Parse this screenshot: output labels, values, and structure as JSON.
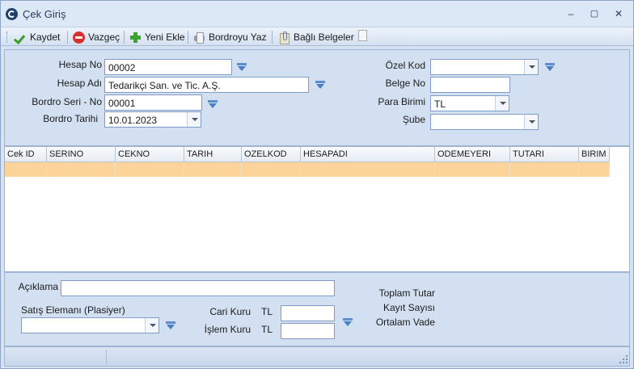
{
  "window": {
    "title": "Çek Giriş",
    "controls": [
      "–",
      "▢",
      "✕"
    ]
  },
  "toolbar": {
    "save_label": "Kaydet",
    "cancel_label": "Vazgeç",
    "new_label": "Yeni Ekle",
    "print_label": "Bordroyu Yaz",
    "attachments_label": "Bağlı Belgeler"
  },
  "header_form": {
    "account_no": {
      "label": "Hesap No",
      "value": "00002"
    },
    "account_name": {
      "label": "Hesap Adı",
      "value": "Tedarikçi San. ve Tic. A.Ş."
    },
    "bordro_serial": {
      "label": "Bordro Seri - No",
      "value": "00001"
    },
    "bordro_date": {
      "label": "Bordro Tarihi",
      "value": "10.01.2023"
    },
    "special_code": {
      "label": "Özel Kod",
      "value": ""
    },
    "document_no": {
      "label": "Belge No",
      "value": ""
    },
    "currency": {
      "label": "Para Birimi",
      "value": "TL"
    },
    "branch": {
      "label": "Şube",
      "value": ""
    }
  },
  "grid": {
    "columns": [
      "Cek ID",
      "SERINO",
      "CEKNO",
      "TARIH",
      "OZELKOD",
      "HESAPADI",
      "ODEMEYERI",
      "TUTARI",
      "BIRIM"
    ],
    "rows": [
      [
        "",
        "",
        "",
        "",
        "",
        "",
        "",
        "",
        ""
      ]
    ]
  },
  "footer_form": {
    "description": {
      "label": "Açıklama",
      "value": ""
    },
    "salesperson": {
      "label": "Satış Elemanı (Plasiyer)",
      "value": ""
    },
    "current_rate": {
      "label": "Cari Kuru",
      "currency": "TL",
      "value": ""
    },
    "transaction_rate": {
      "label": "İşlem Kuru",
      "currency": "TL",
      "value": ""
    },
    "total_amount_label": "Toplam Tutar",
    "record_count_label": "Kayıt Sayısı",
    "average_maturity_label": "Ortalam Vade"
  },
  "colors": {
    "selected_row": "#fcd49a",
    "panel_bg": "#d3e0f1",
    "input_border": "#7f9dc4"
  }
}
